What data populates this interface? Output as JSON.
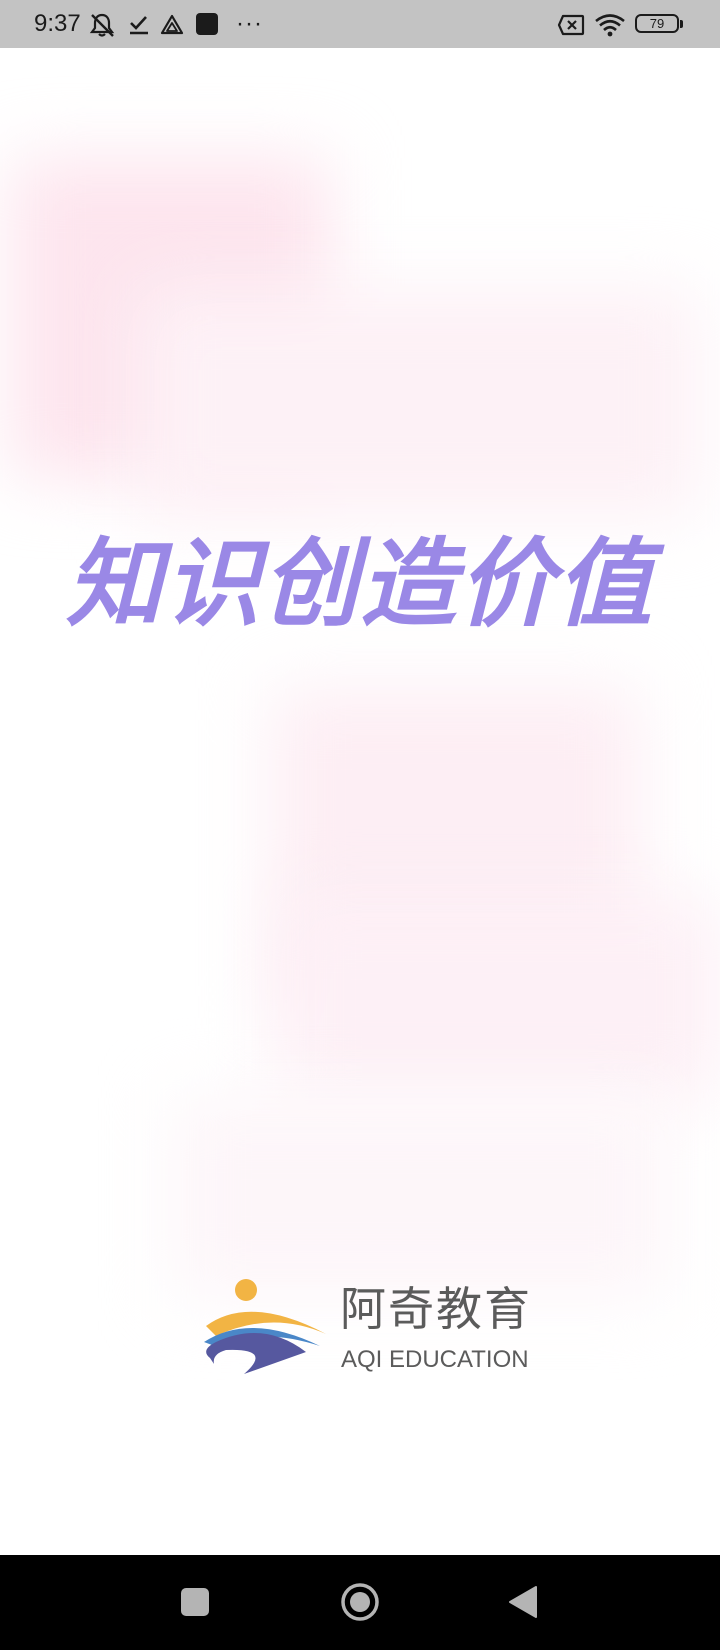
{
  "status_bar": {
    "time": "9:37",
    "more_indicator": "···",
    "battery_level": "79",
    "icons": [
      "muted-bell-icon",
      "download-done-icon",
      "triangle-app-icon",
      "app-square-icon",
      "no-sim-icon",
      "wifi-icon",
      "battery-icon"
    ]
  },
  "splash": {
    "slogan": "知识创造价值",
    "slogan_color": "#9a88e6"
  },
  "brand": {
    "name_cn": "阿奇教育",
    "name_en": "AQI EDUCATION",
    "colors": {
      "orange": "#f2b444",
      "blue": "#4a87c8",
      "navy": "#56589f",
      "text": "#5b5b5b"
    }
  },
  "nav_bar": {
    "buttons": [
      "recents-button",
      "home-button",
      "back-button"
    ]
  }
}
